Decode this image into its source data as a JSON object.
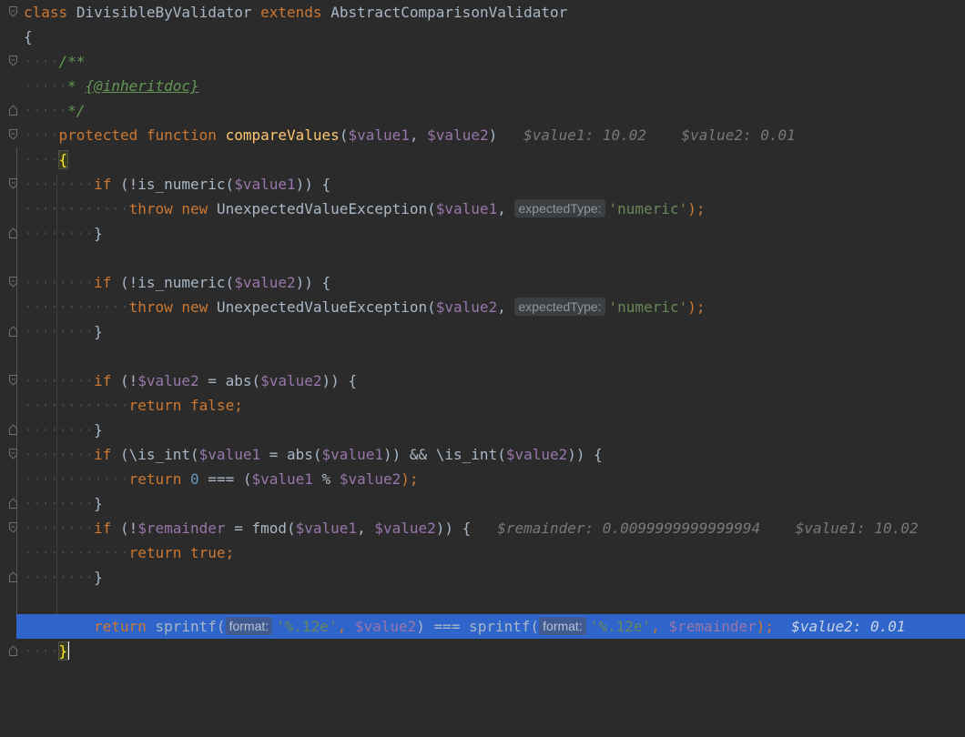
{
  "editor": {
    "class_decl": {
      "kw_class": "class",
      "name": "DivisibleByValidator",
      "kw_extends": "extends",
      "parent": "AbstractComparisonValidator"
    },
    "open_brace": "{",
    "doc_start": "/**",
    "doc_star": "* ",
    "doc_tag": "{@inheritdoc}",
    "doc_end": "*/",
    "method": {
      "kw_protected": "protected",
      "kw_function": "function",
      "name": "compareValues",
      "open": "(",
      "p1": "$value1",
      "comma": ", ",
      "p2": "$value2",
      "close": ")",
      "debug": "$value1: 10.02    $value2: 0.01"
    },
    "method_open": "{",
    "if1": {
      "kw": "if",
      "a": " (!is_numeric(",
      "v": "$value1",
      "b": ")) {"
    },
    "throw1": {
      "kw_throw": "throw",
      "kw_new": "new",
      "cls": " UnexpectedValueException(",
      "v": "$value1",
      "c": ", ",
      "hint": "expectedType:",
      "s": "'numeric'",
      "e": ");"
    },
    "close_brace": "}",
    "if2": {
      "kw": "if",
      "a": " (!is_numeric(",
      "v": "$value2",
      "b": ")) {"
    },
    "throw2": {
      "kw_throw": "throw",
      "kw_new": "new",
      "cls": " UnexpectedValueException(",
      "v": "$value2",
      "c": ", ",
      "hint": "expectedType:",
      "s": "'numeric'",
      "e": ");"
    },
    "if3": {
      "kw": "if",
      "a": " (!",
      "v1": "$value2",
      "b": " = abs(",
      "v2": "$value2",
      "c": ")) {"
    },
    "ret_false": {
      "kw": "return",
      "val": "false",
      "e": ";"
    },
    "if4": {
      "kw": "if",
      "a": " (\\is_int(",
      "v1": "$value1",
      "b": " = abs(",
      "v2": "$value1",
      "c": ")) && \\is_int(",
      "v3": "$value2",
      "d": ")) {"
    },
    "ret_mod": {
      "kw": "return",
      "n": "0",
      "a": " === (",
      "v1": "$value1",
      "b": " % ",
      "v2": "$value2",
      "c": ");"
    },
    "if5": {
      "kw": "if",
      "a": " (!",
      "v1": "$remainder",
      "b": " = fmod(",
      "v2": "$value1",
      "c": ", ",
      "v3": "$value2",
      "d": ")) {",
      "debug": "$remainder: 0.0099999999999994    $value1: 10.02"
    },
    "ret_true": {
      "kw": "return",
      "val": "true",
      "e": ";"
    },
    "ret_sprintf": {
      "kw": "return",
      "f1": " sprintf(",
      "hint1": "format:",
      "s1": "'%.12e'",
      "c1": ", ",
      "v1": "$value2",
      "mid": ") === sprintf(",
      "hint2": "format:",
      "s2": "'%.12e'",
      "c2": ", ",
      "v2": "$remainder",
      "end": ");",
      "debug": "$value2: 0.01"
    },
    "method_close": "}"
  }
}
